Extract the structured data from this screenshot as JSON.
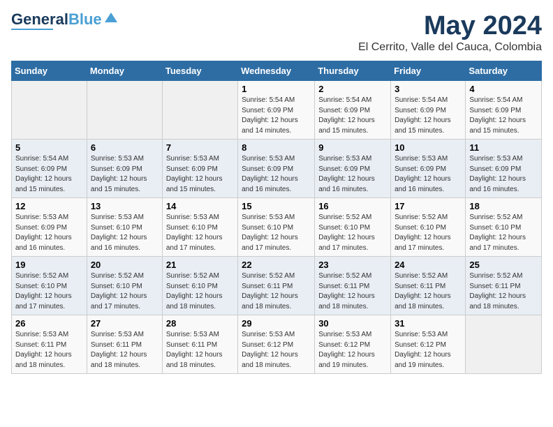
{
  "header": {
    "logo_line1": "General",
    "logo_line2": "Blue",
    "month": "May 2024",
    "location": "El Cerrito, Valle del Cauca, Colombia"
  },
  "calendar": {
    "days_of_week": [
      "Sunday",
      "Monday",
      "Tuesday",
      "Wednesday",
      "Thursday",
      "Friday",
      "Saturday"
    ],
    "weeks": [
      [
        {
          "day": "",
          "info": ""
        },
        {
          "day": "",
          "info": ""
        },
        {
          "day": "",
          "info": ""
        },
        {
          "day": "1",
          "info": "Sunrise: 5:54 AM\nSunset: 6:09 PM\nDaylight: 12 hours\nand 14 minutes."
        },
        {
          "day": "2",
          "info": "Sunrise: 5:54 AM\nSunset: 6:09 PM\nDaylight: 12 hours\nand 15 minutes."
        },
        {
          "day": "3",
          "info": "Sunrise: 5:54 AM\nSunset: 6:09 PM\nDaylight: 12 hours\nand 15 minutes."
        },
        {
          "day": "4",
          "info": "Sunrise: 5:54 AM\nSunset: 6:09 PM\nDaylight: 12 hours\nand 15 minutes."
        }
      ],
      [
        {
          "day": "5",
          "info": "Sunrise: 5:54 AM\nSunset: 6:09 PM\nDaylight: 12 hours\nand 15 minutes."
        },
        {
          "day": "6",
          "info": "Sunrise: 5:53 AM\nSunset: 6:09 PM\nDaylight: 12 hours\nand 15 minutes."
        },
        {
          "day": "7",
          "info": "Sunrise: 5:53 AM\nSunset: 6:09 PM\nDaylight: 12 hours\nand 15 minutes."
        },
        {
          "day": "8",
          "info": "Sunrise: 5:53 AM\nSunset: 6:09 PM\nDaylight: 12 hours\nand 16 minutes."
        },
        {
          "day": "9",
          "info": "Sunrise: 5:53 AM\nSunset: 6:09 PM\nDaylight: 12 hours\nand 16 minutes."
        },
        {
          "day": "10",
          "info": "Sunrise: 5:53 AM\nSunset: 6:09 PM\nDaylight: 12 hours\nand 16 minutes."
        },
        {
          "day": "11",
          "info": "Sunrise: 5:53 AM\nSunset: 6:09 PM\nDaylight: 12 hours\nand 16 minutes."
        }
      ],
      [
        {
          "day": "12",
          "info": "Sunrise: 5:53 AM\nSunset: 6:09 PM\nDaylight: 12 hours\nand 16 minutes."
        },
        {
          "day": "13",
          "info": "Sunrise: 5:53 AM\nSunset: 6:10 PM\nDaylight: 12 hours\nand 16 minutes."
        },
        {
          "day": "14",
          "info": "Sunrise: 5:53 AM\nSunset: 6:10 PM\nDaylight: 12 hours\nand 17 minutes."
        },
        {
          "day": "15",
          "info": "Sunrise: 5:53 AM\nSunset: 6:10 PM\nDaylight: 12 hours\nand 17 minutes."
        },
        {
          "day": "16",
          "info": "Sunrise: 5:52 AM\nSunset: 6:10 PM\nDaylight: 12 hours\nand 17 minutes."
        },
        {
          "day": "17",
          "info": "Sunrise: 5:52 AM\nSunset: 6:10 PM\nDaylight: 12 hours\nand 17 minutes."
        },
        {
          "day": "18",
          "info": "Sunrise: 5:52 AM\nSunset: 6:10 PM\nDaylight: 12 hours\nand 17 minutes."
        }
      ],
      [
        {
          "day": "19",
          "info": "Sunrise: 5:52 AM\nSunset: 6:10 PM\nDaylight: 12 hours\nand 17 minutes."
        },
        {
          "day": "20",
          "info": "Sunrise: 5:52 AM\nSunset: 6:10 PM\nDaylight: 12 hours\nand 17 minutes."
        },
        {
          "day": "21",
          "info": "Sunrise: 5:52 AM\nSunset: 6:10 PM\nDaylight: 12 hours\nand 18 minutes."
        },
        {
          "day": "22",
          "info": "Sunrise: 5:52 AM\nSunset: 6:11 PM\nDaylight: 12 hours\nand 18 minutes."
        },
        {
          "day": "23",
          "info": "Sunrise: 5:52 AM\nSunset: 6:11 PM\nDaylight: 12 hours\nand 18 minutes."
        },
        {
          "day": "24",
          "info": "Sunrise: 5:52 AM\nSunset: 6:11 PM\nDaylight: 12 hours\nand 18 minutes."
        },
        {
          "day": "25",
          "info": "Sunrise: 5:52 AM\nSunset: 6:11 PM\nDaylight: 12 hours\nand 18 minutes."
        }
      ],
      [
        {
          "day": "26",
          "info": "Sunrise: 5:53 AM\nSunset: 6:11 PM\nDaylight: 12 hours\nand 18 minutes."
        },
        {
          "day": "27",
          "info": "Sunrise: 5:53 AM\nSunset: 6:11 PM\nDaylight: 12 hours\nand 18 minutes."
        },
        {
          "day": "28",
          "info": "Sunrise: 5:53 AM\nSunset: 6:11 PM\nDaylight: 12 hours\nand 18 minutes."
        },
        {
          "day": "29",
          "info": "Sunrise: 5:53 AM\nSunset: 6:12 PM\nDaylight: 12 hours\nand 18 minutes."
        },
        {
          "day": "30",
          "info": "Sunrise: 5:53 AM\nSunset: 6:12 PM\nDaylight: 12 hours\nand 19 minutes."
        },
        {
          "day": "31",
          "info": "Sunrise: 5:53 AM\nSunset: 6:12 PM\nDaylight: 12 hours\nand 19 minutes."
        },
        {
          "day": "",
          "info": ""
        }
      ]
    ]
  }
}
